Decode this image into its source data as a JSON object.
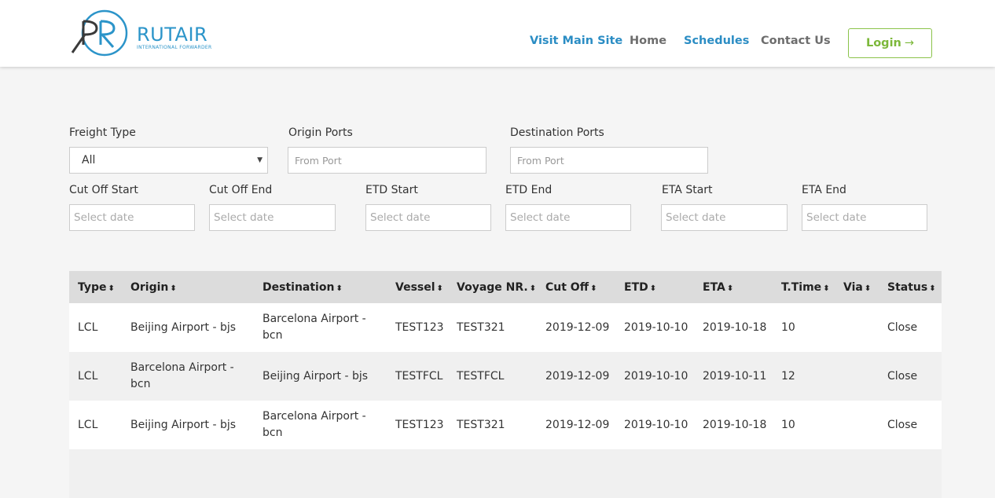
{
  "brand": {
    "name": "RUTAIR",
    "tagline": "INTERNATIONAL FORWARDER",
    "color": "#2b94c9"
  },
  "nav": {
    "items": [
      {
        "label": "Visit Main Site"
      },
      {
        "label": "Home"
      },
      {
        "label": "Schedules"
      },
      {
        "label": "Contact Us"
      }
    ],
    "login_label": "Login"
  },
  "filters": {
    "freight_type": {
      "label": "Freight Type",
      "value": "All"
    },
    "origin_ports": {
      "label": "Origin Ports",
      "placeholder": "From Port"
    },
    "destination_ports": {
      "label": "Destination Ports",
      "placeholder": "From Port"
    },
    "dates": [
      {
        "label": "Cut Off Start",
        "placeholder": "Select date"
      },
      {
        "label": "Cut Off End",
        "placeholder": "Select date"
      },
      {
        "label": "ETD Start",
        "placeholder": "Select date"
      },
      {
        "label": "ETD End",
        "placeholder": "Select date"
      },
      {
        "label": "ETA Start",
        "placeholder": "Select date"
      },
      {
        "label": "ETA End",
        "placeholder": "Select date"
      }
    ]
  },
  "table": {
    "columns": [
      "Type",
      "Origin",
      "Destination",
      "Vessel",
      "Voyage NR.",
      "Cut Off",
      "ETD",
      "ETA",
      "T.Time",
      "Via",
      "Status"
    ],
    "rows": [
      [
        "LCL",
        "Beijing Airport - bjs",
        "Barcelona Airport - bcn",
        "TEST123",
        "TEST321",
        "2019-12-09",
        "2019-10-10",
        "2019-10-18",
        "10",
        "",
        "Close"
      ],
      [
        "LCL",
        "Barcelona Airport - bcn",
        "Beijing Airport - bjs",
        "TESTFCL",
        "TESTFCL",
        "2019-12-09",
        "2019-10-10",
        "2019-10-11",
        "12",
        "",
        "Close"
      ],
      [
        "LCL",
        "Beijing Airport - bjs",
        "Barcelona Airport - bcn",
        "TEST123",
        "TEST321",
        "2019-12-09",
        "2019-10-10",
        "2019-10-18",
        "10",
        "",
        "Close"
      ],
      [
        "",
        "",
        "",
        "",
        "",
        "",
        "",
        "",
        "",
        "",
        ""
      ]
    ]
  }
}
